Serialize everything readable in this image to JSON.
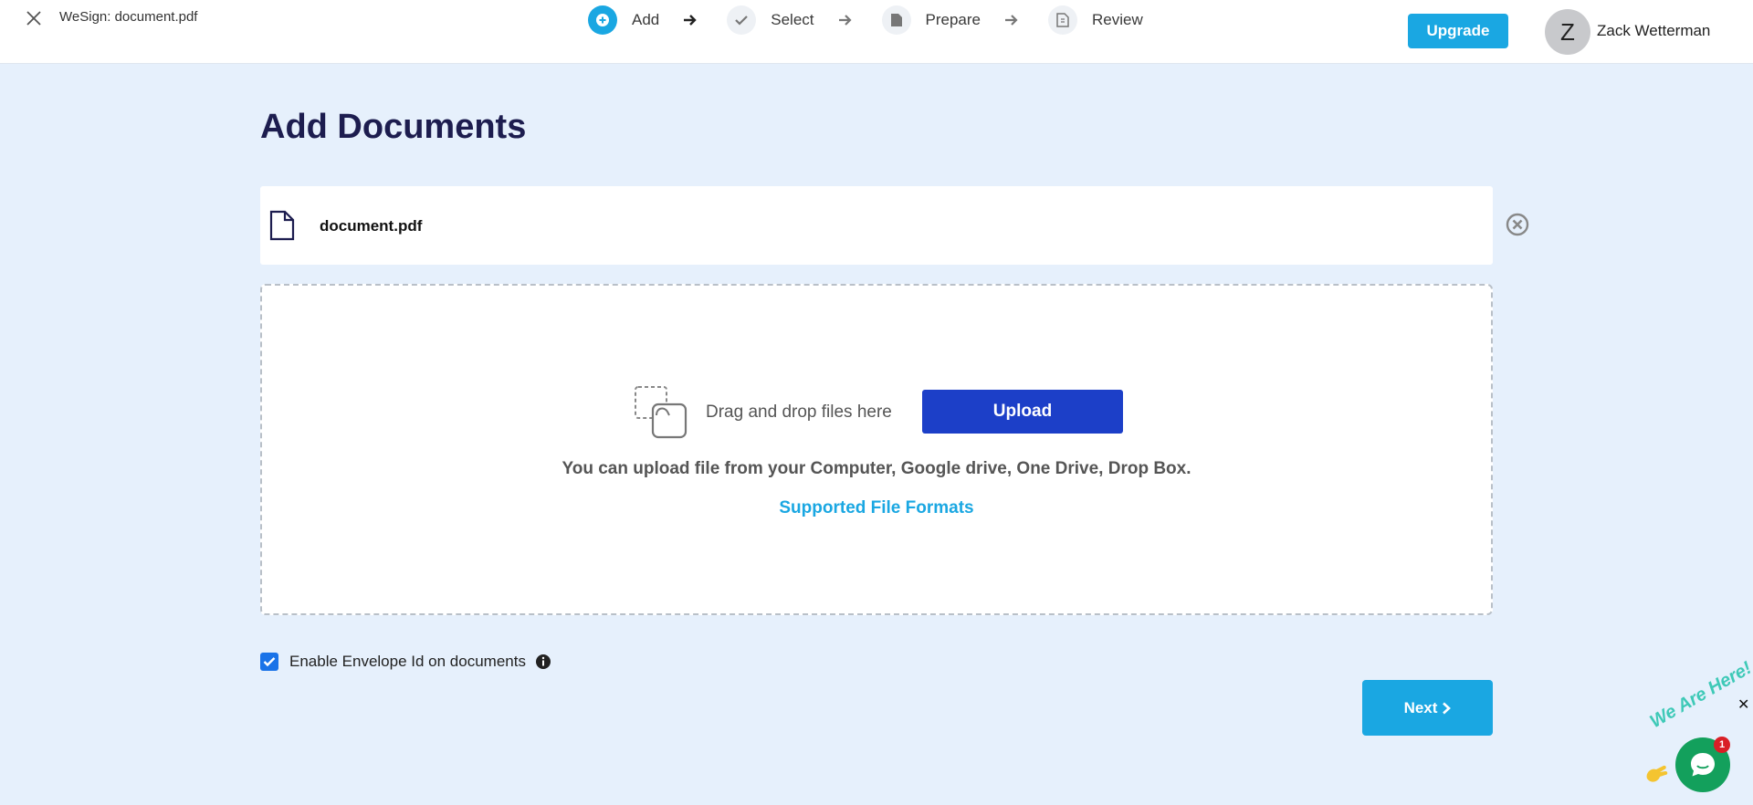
{
  "header": {
    "doc_title": "WeSign: document.pdf",
    "steps": [
      {
        "label": "Add",
        "icon": "plus-circle-icon",
        "active": true
      },
      {
        "label": "Select",
        "icon": "check-icon",
        "active": false
      },
      {
        "label": "Prepare",
        "icon": "file-icon",
        "active": false
      },
      {
        "label": "Review",
        "icon": "file-review-icon",
        "active": false
      }
    ],
    "upgrade_label": "Upgrade",
    "avatar_initial": "Z",
    "user_name": "Zack Wetterman"
  },
  "main": {
    "title": "Add Documents",
    "file": {
      "name": "document.pdf"
    },
    "dropzone": {
      "drag_text": "Drag and drop files here",
      "upload_label": "Upload",
      "info_text": "You can upload file from your Computer, Google drive, One Drive, Drop Box.",
      "formats_link": "Supported File Formats"
    },
    "envelope": {
      "label": "Enable Envelope Id on documents",
      "checked": true
    },
    "next_label": "Next"
  },
  "chat": {
    "tagline": "We Are Here!",
    "badge_count": "1",
    "close_glyph": "✕"
  },
  "colors": {
    "accent": "#1aa7e2",
    "primary": "#1c3fc8",
    "background": "#e6f0fc",
    "chat": "#13a05c",
    "badge": "#d91f26"
  }
}
